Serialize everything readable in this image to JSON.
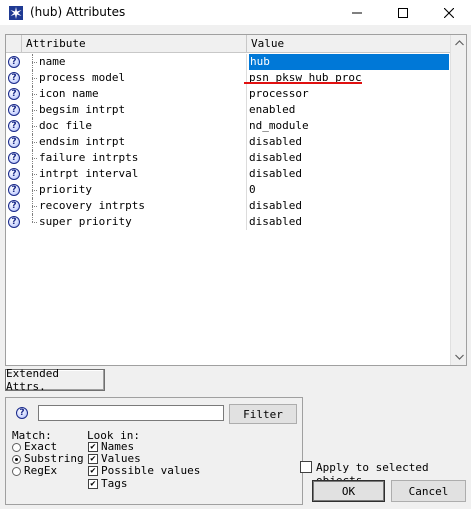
{
  "window": {
    "title": "(hub) Attributes",
    "icon": "opnet-star-icon"
  },
  "table": {
    "headers": {
      "attribute": "Attribute",
      "value": "Value"
    },
    "rows": [
      {
        "name": "name",
        "value": "hub"
      },
      {
        "name": "process model",
        "value": "psn_pksw_hub_proc"
      },
      {
        "name": "icon name",
        "value": "processor"
      },
      {
        "name": "begsim intrpt",
        "value": "enabled"
      },
      {
        "name": "doc file",
        "value": "nd_module"
      },
      {
        "name": "endsim intrpt",
        "value": "disabled"
      },
      {
        "name": "failure intrpts",
        "value": "disabled"
      },
      {
        "name": "intrpt interval",
        "value": "disabled"
      },
      {
        "name": "priority",
        "value": "0"
      },
      {
        "name": "recovery intrpts",
        "value": "disabled"
      },
      {
        "name": "super priority",
        "value": "disabled"
      }
    ],
    "selected_row": 0,
    "highlight_color": "#0078d7",
    "annotation_color": "#e01010"
  },
  "buttons": {
    "extended": "Extended Attrs.",
    "filter": "Filter",
    "ok": "OK",
    "cancel": "Cancel"
  },
  "filter": {
    "input_value": "",
    "match_label": "Match:",
    "match_options": [
      "Exact",
      "Substring",
      "RegEx"
    ],
    "match_selected": "Substring",
    "lookin_label": "Look in:",
    "lookin_options": [
      {
        "label": "Names",
        "checked": true
      },
      {
        "label": "Values",
        "checked": true
      },
      {
        "label": "Possible values",
        "checked": true
      },
      {
        "label": "Tags",
        "checked": true
      }
    ]
  },
  "apply_to_selected": {
    "label": "Apply to selected objects",
    "checked": false
  }
}
